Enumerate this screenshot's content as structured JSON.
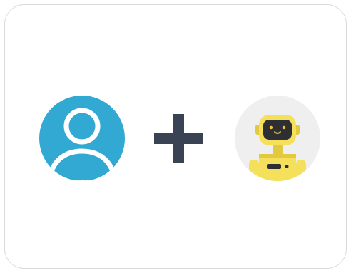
{
  "icons": {
    "user": "user-icon",
    "plus": "plus-icon",
    "robot": "robot-icon"
  },
  "colors": {
    "user_circle": "#31a9d2",
    "plus": "#3a4354",
    "robot_bg": "#efefef",
    "robot_body": "#f4e05a",
    "robot_shade": "#e3c93f",
    "robot_screen": "#2e2f33",
    "robot_eyes": "#f2c23a"
  }
}
